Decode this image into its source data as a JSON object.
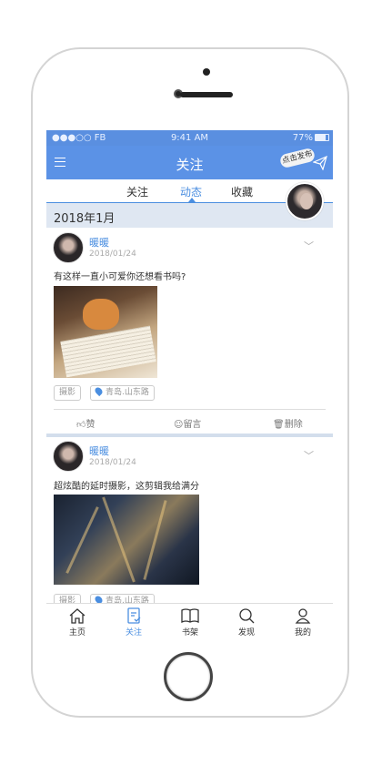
{
  "status_bar": {
    "carrier": "●●●○○ FB",
    "time": "9:41 AM",
    "battery": "77%"
  },
  "header": {
    "title": "关注",
    "publish_bubble": "点击发布"
  },
  "tabs": [
    {
      "label": "关注",
      "active": false
    },
    {
      "label": "动态",
      "active": true
    },
    {
      "label": "收藏",
      "active": false
    }
  ],
  "month_header": "2018年1月",
  "posts": [
    {
      "author": "暖暖",
      "date": "2018/01/24",
      "text": "有这样一直小可爱你还想看书吗?",
      "tags": [
        "摄影",
        "青岛.山东路"
      ],
      "actions": {
        "like": "赞",
        "comment": "留言",
        "delete": "删除"
      }
    },
    {
      "author": "暖暖",
      "date": "2018/01/24",
      "text": "超炫酷的延时摄影，这剪辑我给满分",
      "tags": [
        "摄影",
        "青岛.山东路"
      ]
    }
  ],
  "bottom_nav": [
    {
      "label": "主页",
      "icon": "home-icon",
      "active": false
    },
    {
      "label": "关注",
      "icon": "follow-icon",
      "active": true
    },
    {
      "label": "书架",
      "icon": "book-icon",
      "active": false
    },
    {
      "label": "发现",
      "icon": "search-icon",
      "active": false
    },
    {
      "label": "我的",
      "icon": "user-icon",
      "active": false
    }
  ],
  "colors": {
    "accent": "#4a8ee0",
    "header": "#5b92e6",
    "month_bar": "#dfe7f2"
  }
}
